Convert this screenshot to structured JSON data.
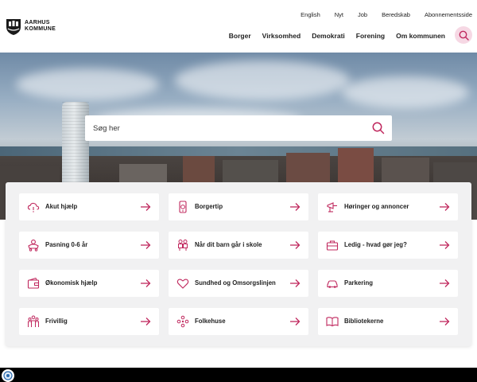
{
  "header": {
    "logo_line1": "AARHUS",
    "logo_line2": "KOMMUNE",
    "utility_nav": [
      "English",
      "Nyt",
      "Job",
      "Beredskab",
      "Abonnementsside"
    ],
    "main_nav": [
      "Borger",
      "Virksomhed",
      "Demokrati",
      "Forening",
      "Om kommunen"
    ]
  },
  "hero": {
    "search_placeholder": "Søg her"
  },
  "tiles": [
    {
      "label": "Akut hjælp",
      "icon": "cloud-warning-icon"
    },
    {
      "label": "Borgertip",
      "icon": "phone-tip-icon"
    },
    {
      "label": "Høringer og annoncer",
      "icon": "megaphone-icon"
    },
    {
      "label": "Pasning 0-6 år",
      "icon": "stroller-icon"
    },
    {
      "label": "Når dit barn går i skole",
      "icon": "school-children-icon"
    },
    {
      "label": "Ledig - hvad gør jeg?",
      "icon": "briefcase-icon"
    },
    {
      "label": "Økonomisk hjælp",
      "icon": "wallet-icon"
    },
    {
      "label": "Sundhed og Omsorgslinjen",
      "icon": "heart-icon"
    },
    {
      "label": "Parkering",
      "icon": "car-icon"
    },
    {
      "label": "Frivillig",
      "icon": "people-group-icon"
    },
    {
      "label": "Folkehuse",
      "icon": "community-icon"
    },
    {
      "label": "Bibliotekerne",
      "icon": "book-icon"
    }
  ],
  "colors": {
    "accent": "#c0285e",
    "search_circle_bg": "#f6d8e4",
    "panel_bg": "#f1f1f2"
  }
}
